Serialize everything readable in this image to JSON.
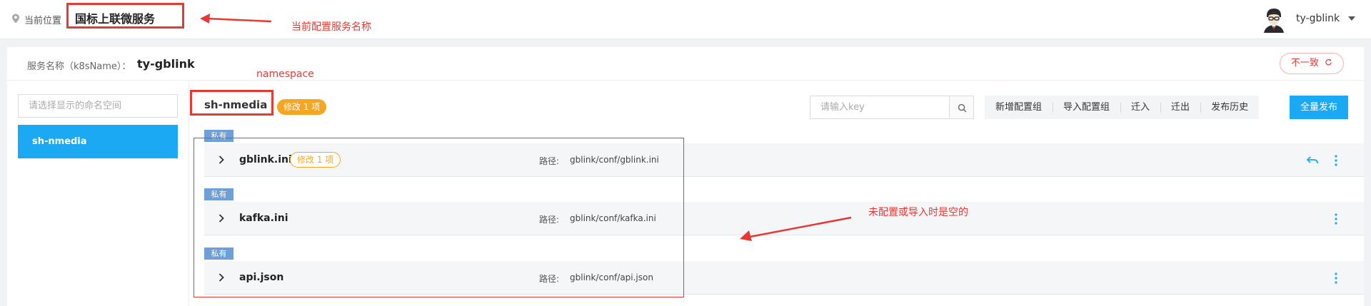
{
  "header": {
    "location_label": "当前位置",
    "breadcrumb": "国标上联微服务",
    "user_name": "ty-gblink"
  },
  "annotations": {
    "service_name_note": "当前配置服务名称",
    "namespace_note": "namespace",
    "empty_note": "未配置或导入时是空的"
  },
  "service": {
    "label": "服务名称（k8sName）：",
    "name": "ty-gblink",
    "status_button": "不一致"
  },
  "sidebar": {
    "filter_placeholder": "请选择显示的命名空间",
    "items": [
      {
        "label": "sh-nmedia"
      }
    ]
  },
  "namespace": {
    "name": "sh-nmedia",
    "modified_badge": "修改 1 项",
    "search_placeholder": "请输入key",
    "actions": [
      "新增配置组",
      "导入配置组",
      "迁入",
      "迁出",
      "发布历史"
    ],
    "publish_all": "全量发布"
  },
  "files": [
    {
      "tag": "私有",
      "name": "gblink.ini",
      "badge": "修改 1 项",
      "path_label": "路径:",
      "path": "gblink/conf/gblink.ini"
    },
    {
      "tag": "私有",
      "name": "kafka.ini",
      "path_label": "路径:",
      "path": "gblink/conf/kafka.ini"
    },
    {
      "tag": "私有",
      "name": "api.json",
      "path_label": "路径:",
      "path": "gblink/conf/api.json"
    }
  ],
  "colors": {
    "accent": "#1ba9f4",
    "annotation": "#e53935",
    "badge": "#f5a623",
    "tag": "#6e9fd6"
  }
}
